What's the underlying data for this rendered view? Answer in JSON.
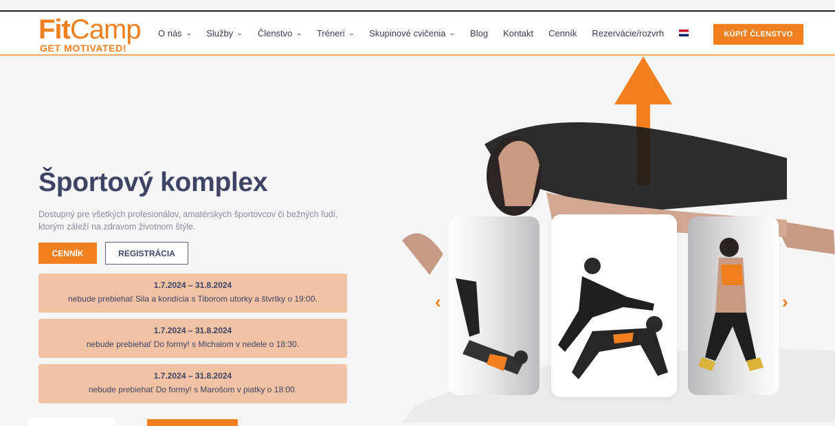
{
  "logo": {
    "part1": "Fit",
    "part2": "Camp",
    "tagline": "GET MOTIVATED!"
  },
  "nav": {
    "items": [
      {
        "label": "O nás",
        "dropdown": true
      },
      {
        "label": "Služby",
        "dropdown": true
      },
      {
        "label": "Členstvo",
        "dropdown": true
      },
      {
        "label": "Tréneri",
        "dropdown": true
      },
      {
        "label": "Skupinové cvičenia",
        "dropdown": true
      },
      {
        "label": "Blog",
        "dropdown": false
      },
      {
        "label": "Kontakt",
        "dropdown": false
      },
      {
        "label": "Cenník",
        "dropdown": false
      },
      {
        "label": "Rezervácie/rozvrh",
        "dropdown": false
      }
    ],
    "flag_icon": "uk-flag-icon",
    "buy_button": "KÚPIŤ ČLENSTVO"
  },
  "hero": {
    "title": "Športový komplex",
    "description": "Dostupný pre všetkých profesionálov, amatérskych športovcov či bežných ľudí, ktorým záleží na zdravom životnom štýle.",
    "btn_primary": "CENNÍK",
    "btn_secondary": "REGISTRÁCIA"
  },
  "notices": [
    {
      "date": "1.7.2024 – 31.8.2024",
      "text": "nebude prebiehať Sila a kondícia s Tiborom utorky a štvrtky o 19:00."
    },
    {
      "date": "1.7.2024 – 31.8.2024",
      "text": "nebude prebiehať Do formy! s Michalom v nedele o 18:30."
    },
    {
      "date": "1.7.2024 – 31.8.2024",
      "text": "nebude prebiehať Do formy! s Marošom v piatky o 18:00."
    }
  ],
  "carousel": {
    "prev_icon": "chevron-left-icon",
    "next_icon": "chevron-right-icon",
    "prev": "‹",
    "next": "›"
  },
  "colors": {
    "accent": "#f07f1f",
    "title": "#3d4465",
    "notice_bg": "#f1c2a3"
  }
}
